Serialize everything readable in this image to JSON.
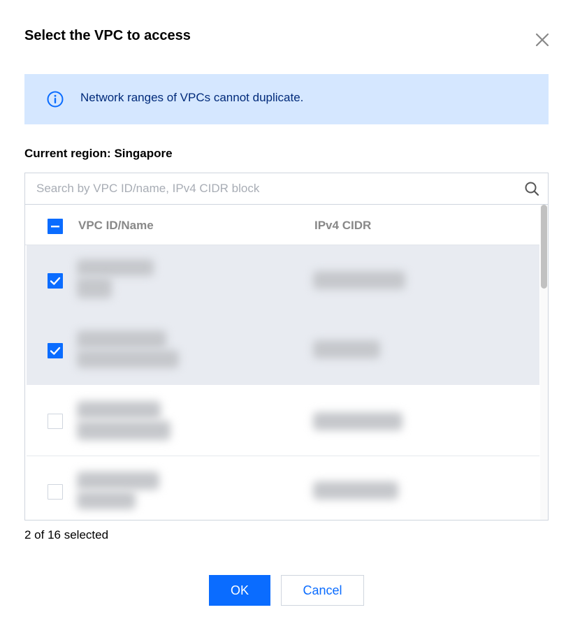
{
  "dialog": {
    "title": "Select the VPC to access",
    "close_icon": "close-icon"
  },
  "notice": {
    "icon": "info-icon",
    "text": "Network ranges of VPCs cannot duplicate."
  },
  "region_label": "Current region: Singapore",
  "search": {
    "placeholder": "Search by VPC ID/name, IPv4 CIDR block",
    "value": "",
    "icon": "search-icon"
  },
  "table": {
    "columns": [
      "VPC ID/Name",
      "IPv4 CIDR"
    ],
    "header_checkbox": "partial",
    "rows": [
      {
        "checked": true
      },
      {
        "checked": true
      },
      {
        "checked": false
      },
      {
        "checked": false
      }
    ]
  },
  "selection_count": "2 of 16 selected",
  "buttons": {
    "ok": "OK",
    "cancel": "Cancel"
  },
  "colors": {
    "accent": "#0a6cff",
    "notice_bg": "#d5e7ff",
    "selected_row_bg": "#e8ebf1"
  }
}
